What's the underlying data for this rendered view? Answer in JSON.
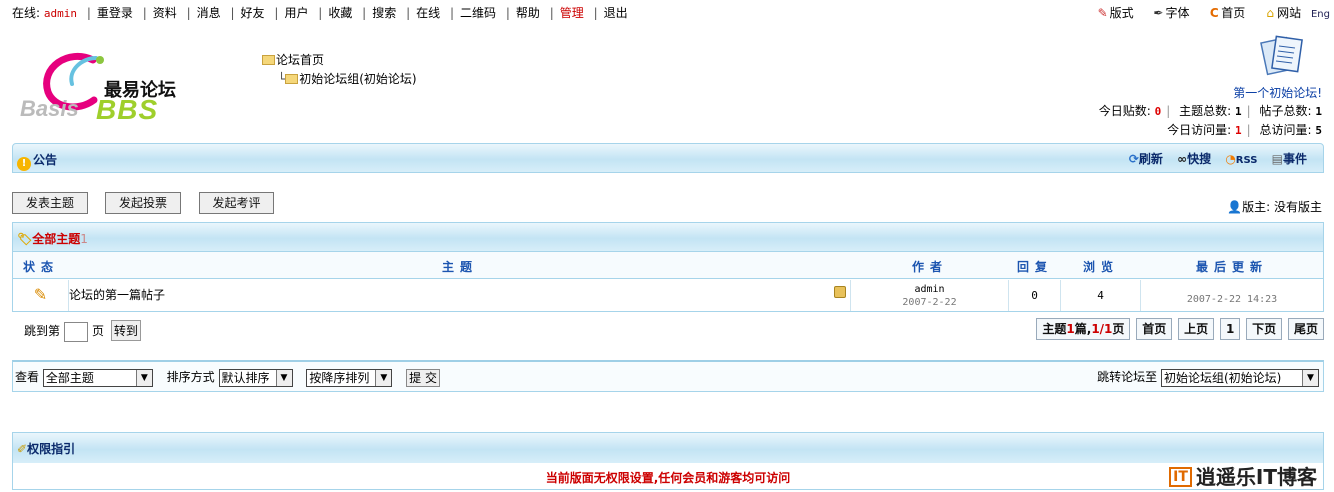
{
  "topnav": {
    "online_label": "在线:",
    "username": "admin",
    "items": [
      "重登录",
      "资料",
      "消息",
      "好友",
      "用户",
      "收藏",
      "搜索",
      "在线",
      "二维码",
      "帮助",
      "管理",
      "退出"
    ]
  },
  "toptools": {
    "style": "版式",
    "font": "字体",
    "home": "首页",
    "site": "网站",
    "lang": "Eng"
  },
  "logo": {
    "cn": "最易论坛",
    "basis": "Basis",
    "bbs": "BBS"
  },
  "tree": {
    "root": "论坛首页",
    "child": "初始论坛组(初始论坛)"
  },
  "stats": {
    "forum_name": "第一个初始论坛!",
    "today_posts_label": "今日贴数:",
    "today_posts": "0",
    "topics_label": "主题总数:",
    "topics": "1",
    "posts_label": "帖子总数:",
    "posts": "1",
    "today_visits_label": "今日访问量:",
    "today_visits": "1",
    "total_visits_label": "总访问量:",
    "total_visits": "5"
  },
  "notice": {
    "title": "公告",
    "refresh": "刷新",
    "snapshot": "快搜",
    "rss": "RSS",
    "events": "事件"
  },
  "buttons": {
    "new_topic": "发表主题",
    "new_poll": "发起投票",
    "new_review": "发起考评"
  },
  "moderator": "版主: 没有版主",
  "topics": {
    "title": "全部主题",
    "count": "1",
    "columns": {
      "status": "状态",
      "subject": "主题",
      "author": "作者",
      "replies": "回复",
      "views": "浏览",
      "last": "最后更新"
    },
    "rows": [
      {
        "subject": "论坛的第一篇帖子",
        "author": "admin",
        "date": "2007-2-22",
        "replies": "0",
        "views": "4",
        "last": "2007-2-22 14:23"
      }
    ]
  },
  "jump": {
    "prefix": "跳到第",
    "suffix": "页",
    "go": "转到"
  },
  "pager": {
    "summary_a": "主题",
    "summary_n": "1",
    "summary_b": "篇,",
    "pages": "1/1",
    "summary_c": "页",
    "first": "首页",
    "prev": "上页",
    "current": "1",
    "next": "下页",
    "last": "尾页"
  },
  "filter": {
    "view_label": "查看",
    "view_value": "全部主题",
    "sort_label": "排序方式",
    "sort_value": "默认排序",
    "order_value": "按降序排列",
    "submit": "提 交",
    "jump_label": "跳转论坛至",
    "jump_value": "初始论坛组(初始论坛)"
  },
  "permissions": {
    "title": "权限指引",
    "message": "当前版面无权限设置,任何会员和游客均可访问"
  },
  "brand": {
    "it": "IT",
    "text": "逍遥乐IT博客"
  }
}
